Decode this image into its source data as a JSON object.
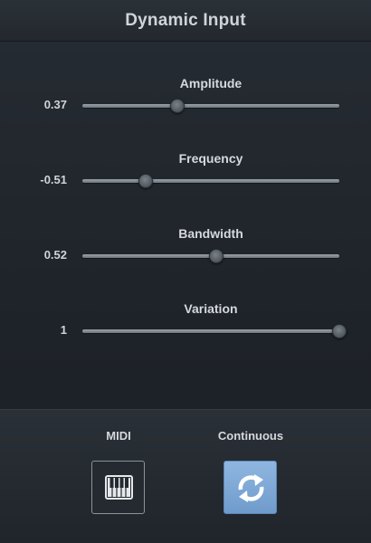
{
  "header": {
    "title": "Dynamic Input"
  },
  "params": [
    {
      "label": "Amplitude",
      "value_text": "0.37",
      "fraction": 0.37
    },
    {
      "label": "Frequency",
      "value_text": "-0.51",
      "fraction": 0.245
    },
    {
      "label": "Bandwidth",
      "value_text": "0.52",
      "fraction": 0.52
    },
    {
      "label": "Variation",
      "value_text": "1",
      "fraction": 1.0
    }
  ],
  "controls": {
    "midi_label": "MIDI",
    "continuous_label": "Continuous"
  },
  "colors": {
    "continuous_active": "#7ea7d6"
  },
  "icons": {
    "midi": "piano-keyboard-icon",
    "continuous": "refresh-icon"
  }
}
